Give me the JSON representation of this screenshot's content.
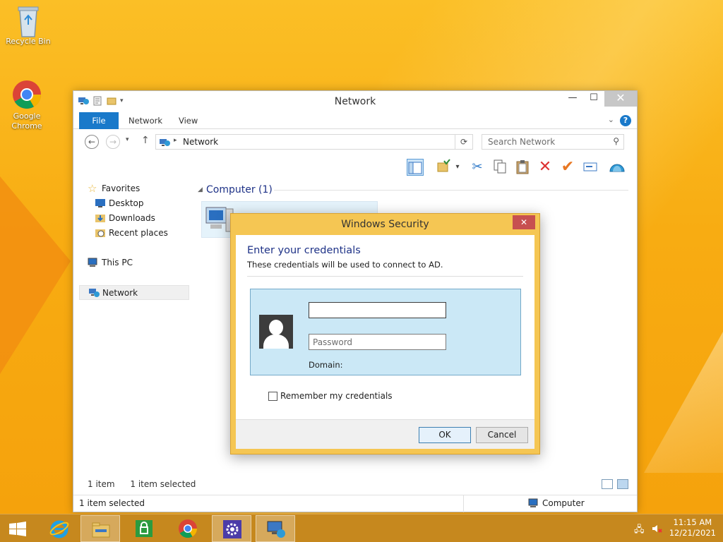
{
  "desktop": {
    "icons": [
      {
        "label": "Recycle Bin",
        "icon": "recycle-bin-icon"
      },
      {
        "label": "Google Chrome",
        "icon": "chrome-icon"
      }
    ]
  },
  "explorer": {
    "title": "Network",
    "tabs": {
      "file": "File",
      "network": "Network",
      "view": "View"
    },
    "address": {
      "path": "Network"
    },
    "search": {
      "placeholder": "Search Network"
    },
    "nav": {
      "favorites": "Favorites",
      "desktop": "Desktop",
      "downloads": "Downloads",
      "recent": "Recent places",
      "this_pc": "This PC",
      "network": "Network"
    },
    "group": {
      "header": "Computer (1)"
    },
    "status": {
      "items": "1 item",
      "selected": "1 item selected"
    },
    "statusbar": {
      "left": "1 item selected",
      "right": "Computer"
    }
  },
  "dialog": {
    "title": "Windows Security",
    "heading": "Enter your credentials",
    "subtext": "These credentials will be used to connect to AD.",
    "username": {
      "value": "",
      "placeholder": ""
    },
    "password": {
      "value": "",
      "placeholder": "Password"
    },
    "domain_label": "Domain:",
    "remember_label": "Remember my credentials",
    "ok_label": "OK",
    "cancel_label": "Cancel"
  },
  "taskbar": {
    "clock": {
      "time": "11:15 AM",
      "date": "12/21/2021"
    }
  },
  "colors": {
    "accent": "#1979ca",
    "heading": "#1e3287",
    "dialog_frame": "#f5c653",
    "taskbar": "#c6881e",
    "cred_box": "#cbe8f6"
  }
}
